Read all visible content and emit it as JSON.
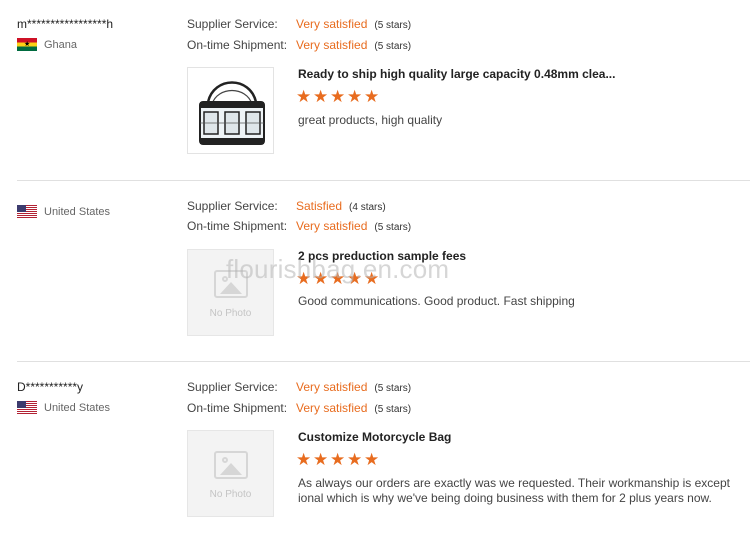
{
  "reviews": [
    {
      "buyer": "m*****************h",
      "country": "Ghana",
      "supplier_service_label": "Supplier Service:",
      "supplier_service_value": "Very satisfied",
      "supplier_service_stars": "(5 stars)",
      "shipment_label": "On-time Shipment:",
      "shipment_value": "Very satisfied",
      "shipment_stars": "(5 stars)",
      "product_title": "Ready to ship high quality large capacity 0.48mm clea...",
      "product_rating": 5,
      "comment": "great products, high quality",
      "has_photo": true
    },
    {
      "buyer": "",
      "country": "United States",
      "supplier_service_label": "Supplier Service:",
      "supplier_service_value": "Satisfied",
      "supplier_service_stars": "(4 stars)",
      "shipment_label": "On-time Shipment:",
      "shipment_value": "Very satisfied",
      "shipment_stars": "(5 stars)",
      "product_title": "2 pcs preduction sample fees",
      "product_rating": 5,
      "comment": "Good communications. Good product. Fast shipping",
      "has_photo": false,
      "no_photo_text": "No Photo"
    },
    {
      "buyer": "D***********y",
      "country": "United States",
      "supplier_service_label": "Supplier Service:",
      "supplier_service_value": "Very satisfied",
      "supplier_service_stars": "(5 stars)",
      "shipment_label": "On-time Shipment:",
      "shipment_value": "Very satisfied",
      "shipment_stars": "(5 stars)",
      "product_title": "Customize Motorcycle Bag",
      "product_rating": 5,
      "comment": "As always our orders are exactly was we requested.  Their workmanship is except ional which is why we've being doing business with them for 2 plus years now.",
      "has_photo": false,
      "no_photo_text": "No Photo"
    }
  ],
  "watermark": "flourishbag.en.com",
  "colors": {
    "accent": "#e86c1f",
    "divider": "#e0e0e0"
  },
  "icons": {
    "star": "star-icon",
    "flag_ghana": "flag-ghana-icon",
    "flag_us": "flag-us-icon",
    "no_photo": "image-placeholder-icon"
  }
}
